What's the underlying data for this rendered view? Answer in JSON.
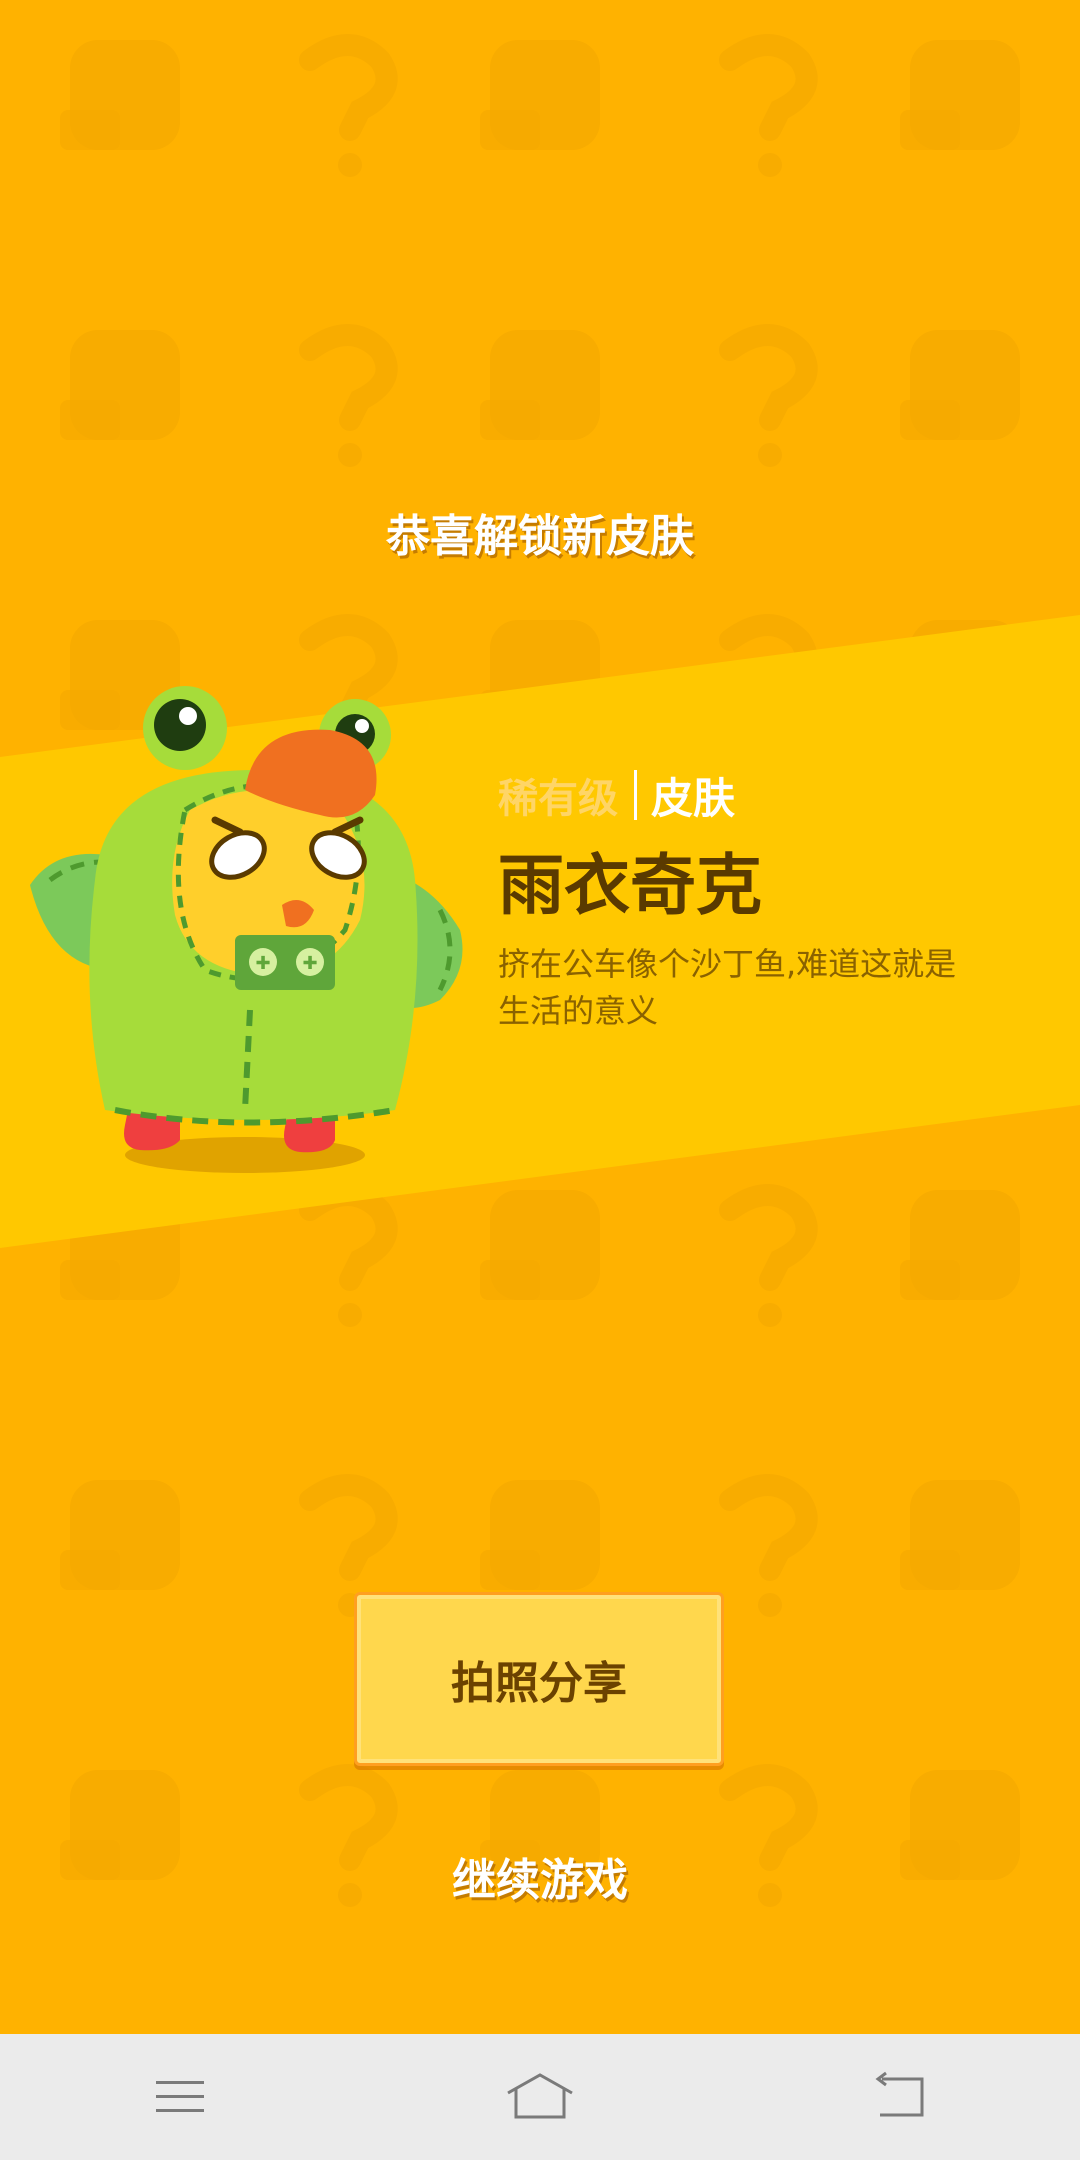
{
  "colors": {
    "background": "#ffb200",
    "stripe": "#ffc800",
    "accent_text": "#5a3a00",
    "button_fill": "#ffd74d",
    "navbar": "#ebebeb"
  },
  "unlock": {
    "title": "恭喜解锁新皮肤"
  },
  "skin": {
    "rarity": "稀有级",
    "type": "皮肤",
    "name": "雨衣奇克",
    "description": "挤在公车像个沙丁鱼,难道这就是生活的意义",
    "character_icon": "chick-in-frog-raincoat"
  },
  "actions": {
    "share_label": "拍照分享",
    "continue_label": "继续游戏"
  },
  "navbar": {
    "items": [
      {
        "icon": "menu-icon"
      },
      {
        "icon": "home-icon"
      },
      {
        "icon": "back-icon"
      }
    ]
  }
}
